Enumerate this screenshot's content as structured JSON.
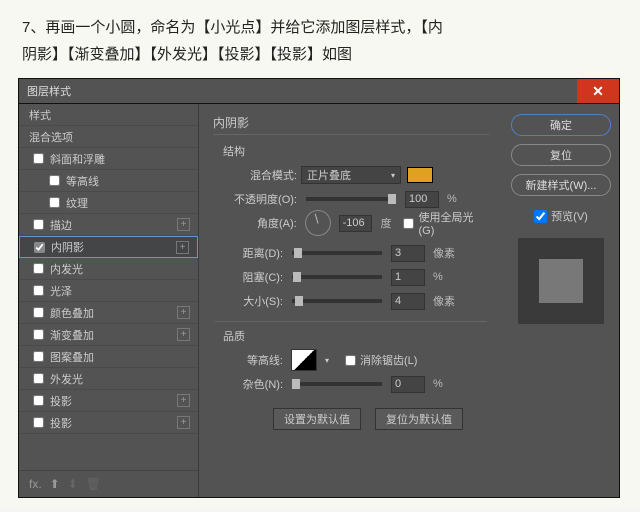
{
  "instruction": {
    "line1": "7、再画一个小圆，命名为【小光点】并给它添加图层样式，【内",
    "line2": "阴影】【渐变叠加】【外发光】【投影】【投影】如图"
  },
  "titlebar": {
    "title": "图层样式",
    "close": "✕"
  },
  "left": {
    "styles_header": "样式",
    "blend_header": "混合选项",
    "bevel": "斜面和浮雕",
    "contour": "等高线",
    "texture": "纹理",
    "stroke": "描边",
    "inner_shadow": "内阴影",
    "inner_glow": "内发光",
    "satin": "光泽",
    "color_overlay": "颜色叠加",
    "gradient_overlay": "渐变叠加",
    "pattern_overlay": "图案叠加",
    "outer_glow": "外发光",
    "drop_shadow1": "投影",
    "drop_shadow2": "投影",
    "plus": "+"
  },
  "center": {
    "section": "内阴影",
    "structure": "结构",
    "blend_mode_lbl": "混合模式:",
    "blend_mode_val": "正片叠底",
    "opacity_lbl": "不透明度(O):",
    "opacity_val": "100",
    "opacity_unit": "%",
    "angle_lbl": "角度(A):",
    "angle_val": "-106",
    "angle_unit": "度",
    "global_light": "使用全局光(G)",
    "distance_lbl": "距离(D):",
    "distance_val": "3",
    "distance_unit": "像素",
    "choke_lbl": "阻塞(C):",
    "choke_val": "1",
    "choke_unit": "%",
    "size_lbl": "大小(S):",
    "size_val": "4",
    "size_unit": "像素",
    "quality": "品质",
    "contour_lbl": "等高线:",
    "anti_alias": "消除锯齿(L)",
    "noise_lbl": "杂色(N):",
    "noise_val": "0",
    "noise_unit": "%",
    "set_default": "设置为默认值",
    "reset_default": "复位为默认值"
  },
  "right": {
    "ok": "确定",
    "reset": "复位",
    "new_style": "新建样式(W)...",
    "preview": "预览(V)"
  },
  "footer": {
    "fx": "fx.",
    "up": "↕",
    "down": "↓",
    "trash": "🗑"
  }
}
